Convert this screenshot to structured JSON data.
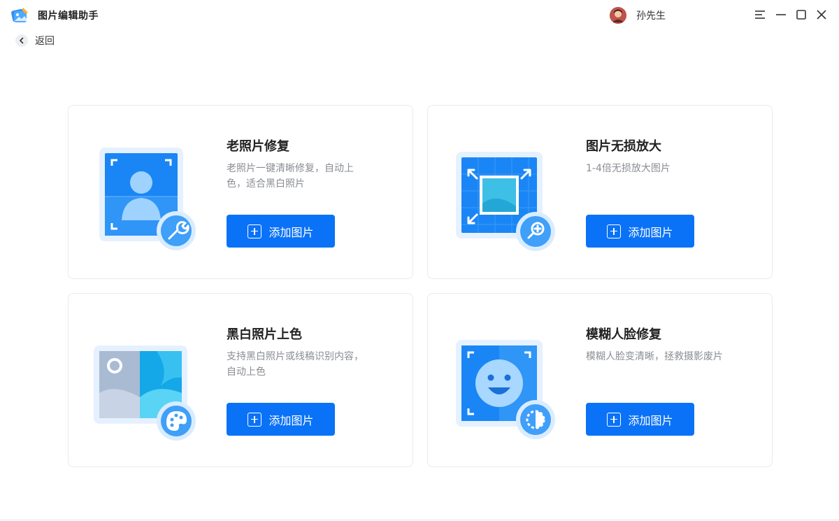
{
  "app": {
    "title": "图片编辑助手"
  },
  "user": {
    "name": "孙先生"
  },
  "nav": {
    "back_label": "返回"
  },
  "colors": {
    "primary": "#0a72f7",
    "illustration": "#2f8ff8",
    "card_border": "#e8eaee"
  },
  "cards": [
    {
      "title": "老照片修复",
      "description": "老照片一键清晰修复，自动上色，适合黑白照片",
      "button_label": "添加图片",
      "icon": "photo-repair-icon"
    },
    {
      "title": "图片无损放大",
      "description": "1-4倍无损放大图片",
      "button_label": "添加图片",
      "icon": "image-enlarge-icon"
    },
    {
      "title": "黑白照片上色",
      "description": "支持黑白照片或线稿识别内容，自动上色",
      "button_label": "添加图片",
      "icon": "colorize-icon"
    },
    {
      "title": "模糊人脸修复",
      "description": "模糊人脸变清晰，拯救摄影废片",
      "button_label": "添加图片",
      "icon": "face-repair-icon"
    }
  ]
}
